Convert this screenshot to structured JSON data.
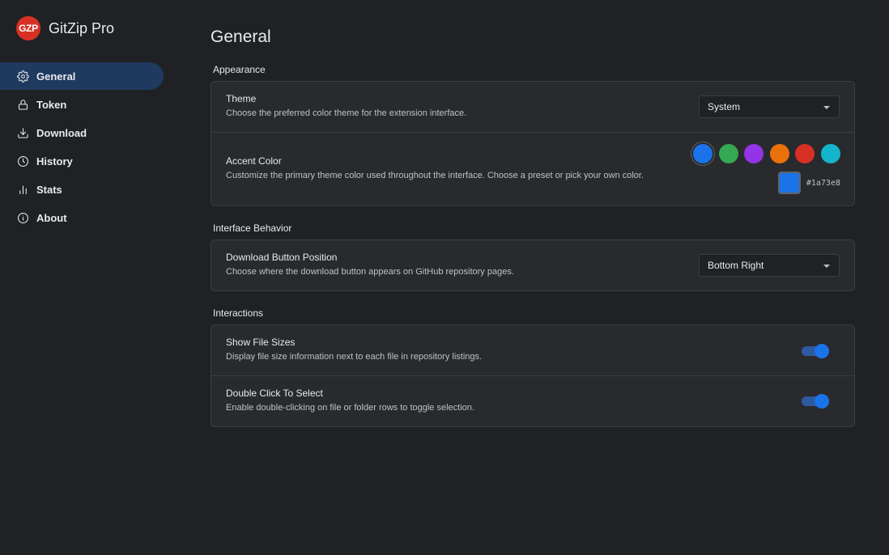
{
  "app": {
    "logo_text": "GZP",
    "name": "GitZip Pro"
  },
  "nav": [
    {
      "label": "General",
      "icon": "gear-icon",
      "active": true
    },
    {
      "label": "Token",
      "icon": "lock-icon",
      "active": false
    },
    {
      "label": "Download",
      "icon": "download-icon",
      "active": false
    },
    {
      "label": "History",
      "icon": "clock-icon",
      "active": false
    },
    {
      "label": "Stats",
      "icon": "bar-chart-icon",
      "active": false
    },
    {
      "label": "About",
      "icon": "info-icon",
      "active": false
    }
  ],
  "page": {
    "title": "General"
  },
  "sections": {
    "appearance": {
      "title": "Appearance",
      "theme": {
        "title": "Theme",
        "desc": "Choose the preferred color theme for the extension interface.",
        "value": "System"
      },
      "accent": {
        "title": "Accent Color",
        "desc": "Customize the primary theme color used throughout the interface. Choose a preset or pick your own color.",
        "presets": [
          "#1a73e8",
          "#34a853",
          "#9334e6",
          "#e8710a",
          "#d93025",
          "#12b5cb"
        ],
        "selected": "#1a73e8",
        "hex": "#1a73e8"
      }
    },
    "interface": {
      "title": "Interface Behavior",
      "download_position": {
        "title": "Download Button Position",
        "desc": "Choose where the download button appears on GitHub repository pages.",
        "value": "Bottom Right"
      }
    },
    "interactions": {
      "title": "Interactions",
      "show_sizes": {
        "title": "Show File Sizes",
        "desc": "Display file size information next to each file in repository listings.",
        "enabled": true
      },
      "double_click": {
        "title": "Double Click To Select",
        "desc": "Enable double-clicking on file or folder rows to toggle selection.",
        "enabled": true
      }
    }
  }
}
